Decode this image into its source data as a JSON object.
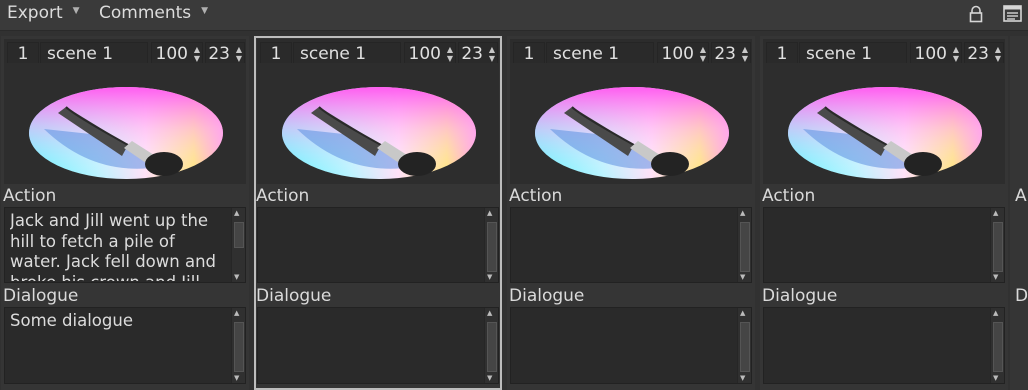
{
  "menubar": {
    "export_label": "Export",
    "comments_label": "Comments"
  },
  "panels": [
    {
      "number": "1",
      "scene": "scene 1",
      "duration": "100",
      "frames": "23",
      "action_label": "Action",
      "action_text": "Jack and Jill went up the hill to fetch a pile of water. Jack fell down and broke his crown and Jill came tumbling after.",
      "dialogue_label": "Dialogue",
      "dialogue_text": "Some dialogue"
    },
    {
      "number": "1",
      "scene": "scene 1",
      "duration": "100",
      "frames": "23",
      "action_label": "Action",
      "action_text": "",
      "dialogue_label": "Dialogue",
      "dialogue_text": ""
    },
    {
      "number": "1",
      "scene": "scene 1",
      "duration": "100",
      "frames": "23",
      "action_label": "Action",
      "action_text": "",
      "dialogue_label": "Dialogue",
      "dialogue_text": ""
    },
    {
      "number": "1",
      "scene": "scene 1",
      "duration": "100",
      "frames": "23",
      "action_label": "Action",
      "action_text": "",
      "dialogue_label": "Dialogue",
      "dialogue_text": ""
    }
  ],
  "edge_panel": {
    "action_initial": "A",
    "dialogue_initial": "D"
  },
  "icons": [
    "lock-icon",
    "view-mode-icon",
    "spin-up-icon",
    "spin-down-icon",
    "scroll-up-icon",
    "scroll-down-icon"
  ],
  "colors": {
    "background": "#313131",
    "panel": "#353535",
    "selected_border": "#bdbdbd"
  }
}
